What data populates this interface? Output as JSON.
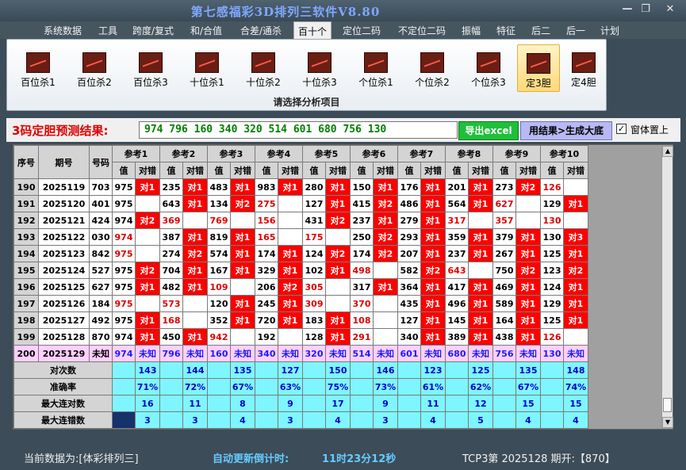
{
  "app": {
    "title": "第七感福彩3D排列三软件V8.80"
  },
  "window_buttons": {
    "minimize": "—",
    "restore": "❐",
    "close": "✕"
  },
  "menu": [
    "系统数据",
    "工具",
    "跨度/复式",
    "和/合值",
    "合差/通杀",
    "百十个",
    "定位二码",
    "不定位二码",
    "振幅",
    "特征",
    "后二",
    "后一",
    "计划"
  ],
  "menu_active_index": 5,
  "ribbon": {
    "buttons": [
      "百位杀1",
      "百位杀2",
      "百位杀3",
      "十位杀1",
      "十位杀2",
      "十位杀3",
      "个位杀1",
      "个位杀2",
      "个位杀3",
      "定3胆",
      "定4胆"
    ],
    "selected_index": 9,
    "caption": "请选择分析项目"
  },
  "prediction": {
    "label": "3码定胆预测结果:",
    "value": "974  796  160  340  320  514  601  680  756  130",
    "export_button": "导出excel",
    "generate_button": "用结果>生成大底",
    "on_top_checked": true,
    "on_top_label": "窗体置上"
  },
  "table": {
    "headers": {
      "seq": "序号",
      "period": "期号",
      "number": "号码",
      "value": "值",
      "result": "对错"
    },
    "ref_headers": [
      "参考1",
      "参考2",
      "参考3",
      "参考4",
      "参考5",
      "参考6",
      "参考7",
      "参考8",
      "参考9",
      "参考10"
    ],
    "rows": [
      {
        "seq": "190",
        "period": "2025119",
        "num": "703",
        "refs": [
          [
            "975",
            "对1",
            "r"
          ],
          [
            "235",
            "对1",
            "r"
          ],
          [
            "483",
            "对1",
            "r"
          ],
          [
            "983",
            "对1",
            "r"
          ],
          [
            "280",
            "对1",
            "r"
          ],
          [
            "150",
            "对1",
            "r"
          ],
          [
            "176",
            "对1",
            "r"
          ],
          [
            "201",
            "对1",
            "r"
          ],
          [
            "273",
            "对2",
            "r"
          ],
          [
            "126",
            "",
            ""
          ]
        ]
      },
      {
        "seq": "191",
        "period": "2025120",
        "num": "401",
        "refs": [
          [
            "975",
            "",
            ""
          ],
          [
            "643",
            "对1",
            "r"
          ],
          [
            "134",
            "对2",
            "r"
          ],
          [
            "275",
            "",
            ""
          ],
          [
            "127",
            "对1",
            "r"
          ],
          [
            "415",
            "对2",
            "r"
          ],
          [
            "486",
            "对1",
            "r"
          ],
          [
            "564",
            "对1",
            "r"
          ],
          [
            "627",
            "",
            ""
          ],
          [
            "129",
            "对1",
            "r"
          ]
        ]
      },
      {
        "seq": "192",
        "period": "2025121",
        "num": "424",
        "refs": [
          [
            "974",
            "对2",
            "r"
          ],
          [
            "369",
            "",
            ""
          ],
          [
            "769",
            "",
            ""
          ],
          [
            "156",
            "",
            ""
          ],
          [
            "431",
            "对2",
            "r"
          ],
          [
            "237",
            "对1",
            "r"
          ],
          [
            "279",
            "对1",
            "r"
          ],
          [
            "317",
            "",
            ""
          ],
          [
            "357",
            "",
            ""
          ],
          [
            "130",
            "",
            ""
          ]
        ]
      },
      {
        "seq": "193",
        "period": "2025122",
        "num": "030",
        "refs": [
          [
            "974",
            "",
            ""
          ],
          [
            "387",
            "对1",
            "r"
          ],
          [
            "819",
            "对1",
            "r"
          ],
          [
            "165",
            "",
            ""
          ],
          [
            "175",
            "",
            ""
          ],
          [
            "250",
            "对2",
            "r"
          ],
          [
            "293",
            "对1",
            "r"
          ],
          [
            "359",
            "对1",
            "r"
          ],
          [
            "379",
            "对1",
            "r"
          ],
          [
            "130",
            "对3",
            "r"
          ]
        ]
      },
      {
        "seq": "194",
        "period": "2025123",
        "num": "842",
        "refs": [
          [
            "975",
            "",
            ""
          ],
          [
            "274",
            "对2",
            "r"
          ],
          [
            "574",
            "对1",
            "r"
          ],
          [
            "174",
            "对1",
            "r"
          ],
          [
            "124",
            "对2",
            "r"
          ],
          [
            "174",
            "对2",
            "r"
          ],
          [
            "207",
            "对1",
            "r"
          ],
          [
            "237",
            "对1",
            "r"
          ],
          [
            "267",
            "对1",
            "r"
          ],
          [
            "125",
            "对1",
            "r"
          ]
        ]
      },
      {
        "seq": "195",
        "period": "2025124",
        "num": "527",
        "refs": [
          [
            "975",
            "对2",
            "r"
          ],
          [
            "704",
            "对1",
            "r"
          ],
          [
            "167",
            "对1",
            "r"
          ],
          [
            "329",
            "对1",
            "r"
          ],
          [
            "102",
            "对1",
            "r"
          ],
          [
            "498",
            "",
            ""
          ],
          [
            "582",
            "对2",
            "r"
          ],
          [
            "643",
            "",
            ""
          ],
          [
            "750",
            "对2",
            "r"
          ],
          [
            "123",
            "对2",
            "r"
          ]
        ]
      },
      {
        "seq": "196",
        "period": "2025125",
        "num": "627",
        "refs": [
          [
            "975",
            "对1",
            "r"
          ],
          [
            "482",
            "对1",
            "r"
          ],
          [
            "109",
            "",
            ""
          ],
          [
            "206",
            "对2",
            "r"
          ],
          [
            "305",
            "",
            ""
          ],
          [
            "317",
            "对1",
            "r"
          ],
          [
            "364",
            "对1",
            "r"
          ],
          [
            "417",
            "对1",
            "r"
          ],
          [
            "469",
            "对1",
            "r"
          ],
          [
            "124",
            "对1",
            "r"
          ]
        ]
      },
      {
        "seq": "197",
        "period": "2025126",
        "num": "184",
        "refs": [
          [
            "975",
            "",
            ""
          ],
          [
            "573",
            "",
            ""
          ],
          [
            "120",
            "对1",
            "r"
          ],
          [
            "245",
            "对1",
            "r"
          ],
          [
            "309",
            "",
            ""
          ],
          [
            "370",
            "",
            ""
          ],
          [
            "435",
            "对1",
            "r"
          ],
          [
            "496",
            "对1",
            "r"
          ],
          [
            "589",
            "对1",
            "r"
          ],
          [
            "129",
            "对1",
            "r"
          ]
        ]
      },
      {
        "seq": "198",
        "period": "2025127",
        "num": "492",
        "refs": [
          [
            "975",
            "对1",
            "r"
          ],
          [
            "168",
            "",
            ""
          ],
          [
            "352",
            "对1",
            "r"
          ],
          [
            "720",
            "对1",
            "r"
          ],
          [
            "183",
            "对1",
            "r"
          ],
          [
            "108",
            "",
            ""
          ],
          [
            "127",
            "对1",
            "r"
          ],
          [
            "145",
            "对1",
            "r"
          ],
          [
            "164",
            "对1",
            "r"
          ],
          [
            "125",
            "对1",
            "r"
          ]
        ]
      },
      {
        "seq": "199",
        "period": "2025128",
        "num": "870",
        "refs": [
          [
            "974",
            "对1",
            "r"
          ],
          [
            "450",
            "对1",
            "r"
          ],
          [
            "942",
            "",
            ""
          ],
          [
            "192",
            "",
            ""
          ],
          [
            "128",
            "对1",
            "r"
          ],
          [
            "291",
            "",
            ""
          ],
          [
            "340",
            "对1",
            "r"
          ],
          [
            "389",
            "对1",
            "r"
          ],
          [
            "438",
            "对1",
            "r"
          ],
          [
            "126",
            "",
            ""
          ]
        ]
      },
      {
        "seq": "200",
        "period": "2025129",
        "num": "未知",
        "refs": [
          [
            "974",
            "未知",
            "p"
          ],
          [
            "796",
            "未知",
            "p"
          ],
          [
            "160",
            "未知",
            "p"
          ],
          [
            "340",
            "未知",
            "p"
          ],
          [
            "320",
            "未知",
            "p"
          ],
          [
            "514",
            "未知",
            "p"
          ],
          [
            "601",
            "未知",
            "p"
          ],
          [
            "680",
            "未知",
            "p"
          ],
          [
            "756",
            "未知",
            "p"
          ],
          [
            "130",
            "未知",
            "p"
          ]
        ]
      }
    ],
    "text_red_cells": [
      [
        "193",
        0
      ],
      [
        "194",
        0
      ],
      [
        "197",
        0
      ],
      [
        "192",
        1
      ],
      [
        "197",
        1
      ],
      [
        "198",
        1
      ],
      [
        "192",
        2
      ],
      [
        "196",
        2
      ],
      [
        "199",
        2
      ],
      [
        "191",
        3
      ],
      [
        "192",
        3
      ],
      [
        "193",
        3
      ],
      [
        "196",
        4
      ],
      [
        "197",
        4
      ],
      [
        "193",
        4
      ],
      [
        "195",
        5
      ],
      [
        "197",
        5
      ],
      [
        "198",
        5
      ],
      [
        "199",
        5
      ],
      [
        "192",
        7
      ],
      [
        "195",
        7
      ],
      [
        "191",
        8
      ],
      [
        "192",
        8
      ],
      [
        "190",
        9
      ],
      [
        "192",
        9
      ],
      [
        "199",
        9
      ]
    ],
    "stats": [
      {
        "label": "对次数",
        "values": [
          "143",
          "144",
          "135",
          "127",
          "150",
          "146",
          "123",
          "125",
          "135",
          "148"
        ]
      },
      {
        "label": "准确率",
        "values": [
          "71%",
          "72%",
          "67%",
          "63%",
          "75%",
          "73%",
          "61%",
          "62%",
          "67%",
          "74%"
        ]
      },
      {
        "label": "最大连对数",
        "values": [
          "16",
          "11",
          "8",
          "9",
          "17",
          "9",
          "11",
          "12",
          "15",
          "15"
        ]
      },
      {
        "label": "最大连错数",
        "values": [
          "3",
          "3",
          "4",
          "3",
          "4",
          "3",
          "4",
          "5",
          "4",
          "4"
        ]
      }
    ]
  },
  "status": {
    "current_data_label": "当前数据为:[体彩排列三]",
    "countdown_label": "自动更新倒计时:",
    "countdown_value": "11时23分12秒",
    "last_draw": "TCP3第 2025128 期开:【870】"
  },
  "colors": {
    "hit": "#ff0000",
    "miss_text": "#e00000",
    "pending": "#ffd0ff",
    "stats_bg": "#7ff6ff"
  }
}
